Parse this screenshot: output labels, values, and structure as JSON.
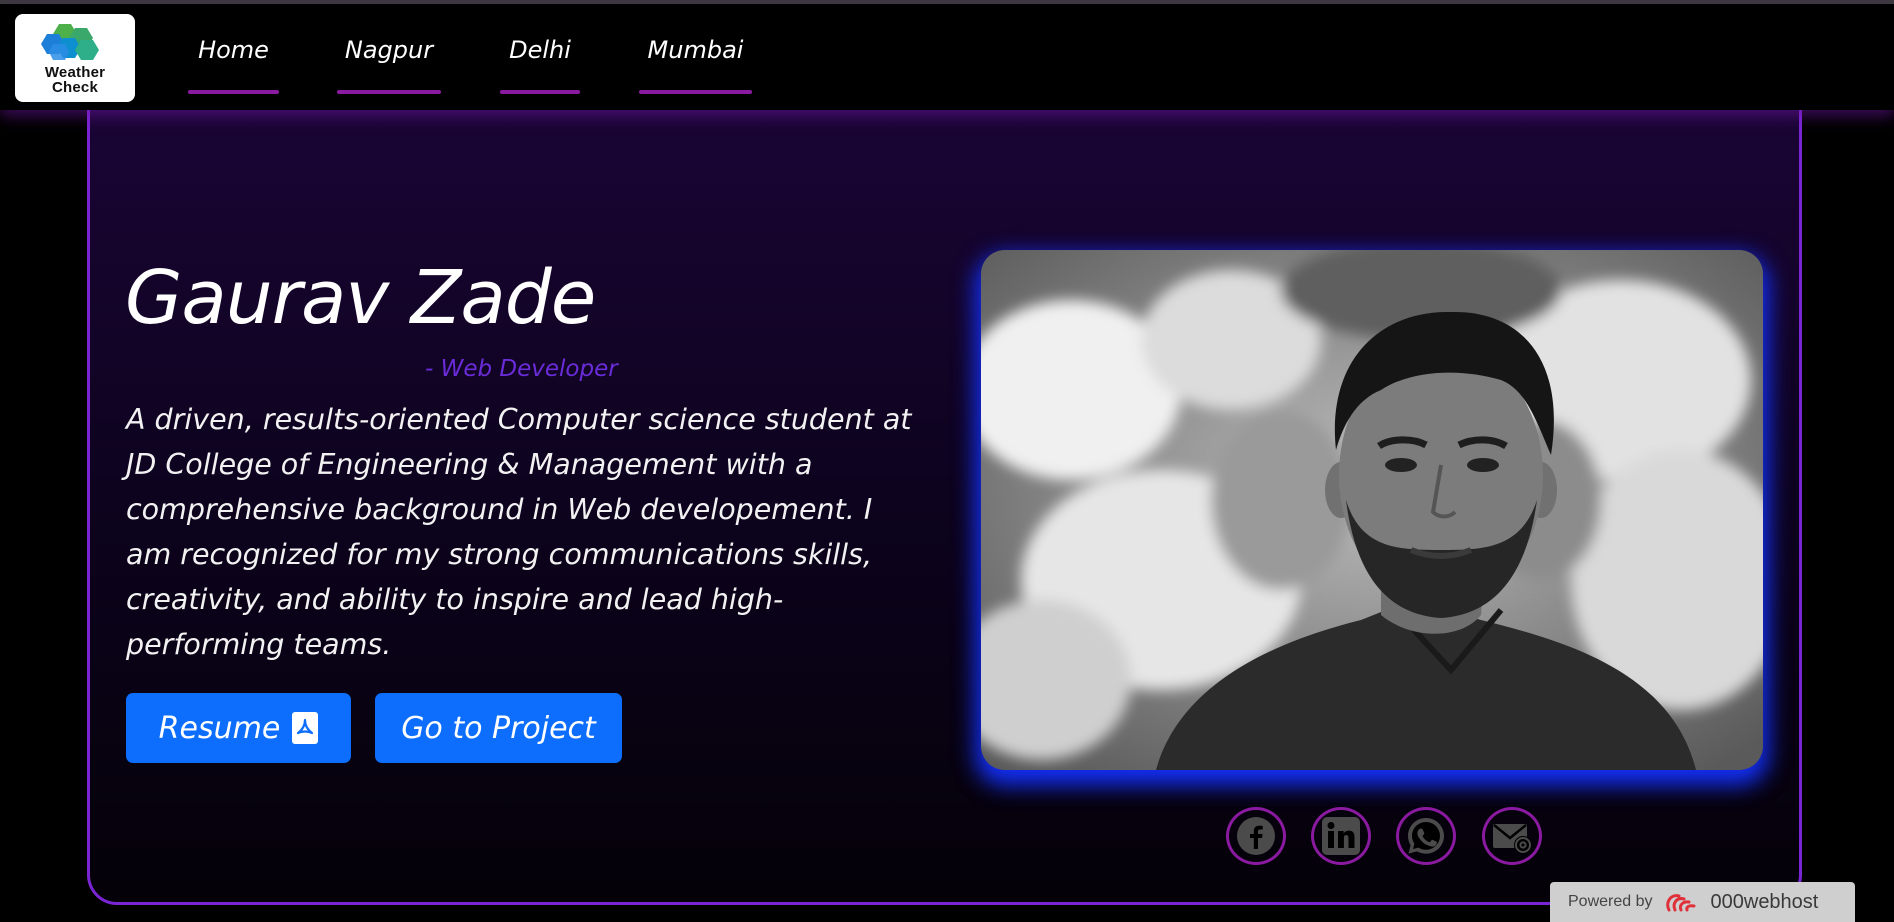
{
  "logo": {
    "line1": "Weather",
    "line2": "Check"
  },
  "nav": [
    {
      "label": "Home"
    },
    {
      "label": "Nagpur"
    },
    {
      "label": "Delhi"
    },
    {
      "label": "Mumbai"
    }
  ],
  "hero": {
    "name": "Gaurav Zade",
    "role": "- Web Developer",
    "bio": "A driven, results-oriented Computer science student at JD College of Engineering & Management with a comprehensive background in Web developement. I am recognized for my strong communications skills, creativity, and ability to inspire and lead high-performing teams.",
    "resume_label": "Resume",
    "project_label": "Go to Project"
  },
  "social": [
    {
      "icon": "facebook-icon"
    },
    {
      "icon": "linkedin-icon"
    },
    {
      "icon": "whatsapp-icon"
    },
    {
      "icon": "email-icon"
    }
  ],
  "host_badge": {
    "powered": "Powered by",
    "host": "000webhost"
  },
  "colors": {
    "accent_purple": "#8a1aa0",
    "border_purple": "#7a25d4",
    "role_text": "#6a2cd8",
    "button_blue": "#0d6efd",
    "photo_glow": "#1432ff",
    "background": "#000000"
  }
}
